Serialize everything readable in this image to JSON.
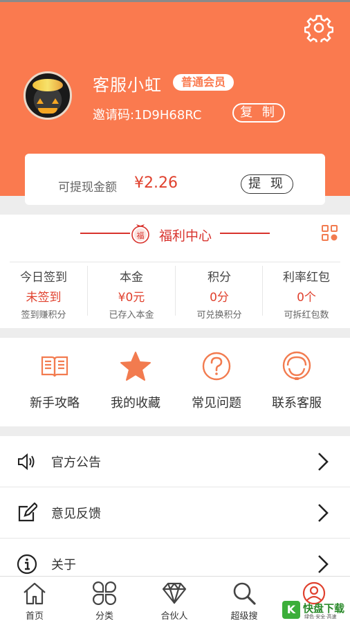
{
  "profile": {
    "username": "客服小虹",
    "member_badge": "普通会员",
    "invite_code": "邀请码:1D9H68RC",
    "copy_label": "复 制"
  },
  "balance": {
    "label": "可提现金额",
    "value": "¥2.26",
    "withdraw_label": "提 现"
  },
  "welfare": {
    "title": "福利中心",
    "fu_char": "福",
    "stats": [
      {
        "title": "今日签到",
        "value": "未签到",
        "sub": "签到赚积分"
      },
      {
        "title": "本金",
        "value": "¥0元",
        "sub": "已存入本金"
      },
      {
        "title": "积分",
        "value": "0分",
        "sub": "可兑换积分"
      },
      {
        "title": "利率红包",
        "value": "0个",
        "sub": "可拆红包数"
      }
    ]
  },
  "quick_links": [
    {
      "label": "新手攻略",
      "icon": "book-icon"
    },
    {
      "label": "我的收藏",
      "icon": "star-icon"
    },
    {
      "label": "常见问题",
      "icon": "question-icon"
    },
    {
      "label": "联系客服",
      "icon": "headset-icon"
    }
  ],
  "menu": [
    {
      "label": "官方公告",
      "icon": "speaker-icon"
    },
    {
      "label": "意见反馈",
      "icon": "edit-icon"
    },
    {
      "label": "关于",
      "icon": "info-icon"
    }
  ],
  "tabbar": [
    {
      "label": "首页",
      "icon": "home-icon"
    },
    {
      "label": "分类",
      "icon": "category-icon"
    },
    {
      "label": "合伙人",
      "icon": "diamond-icon"
    },
    {
      "label": "超级搜",
      "icon": "search-icon"
    },
    {
      "label": "",
      "icon": "user-icon",
      "active": true
    }
  ],
  "watermark": {
    "badge": "K",
    "title": "快盘下载",
    "subtitle": "绿色·安全·高速"
  },
  "colors": {
    "header": "#fa7a4f",
    "accent_red": "#e0412e",
    "welfare_red": "#d8322c",
    "icon_orange": "#f27b4f"
  }
}
